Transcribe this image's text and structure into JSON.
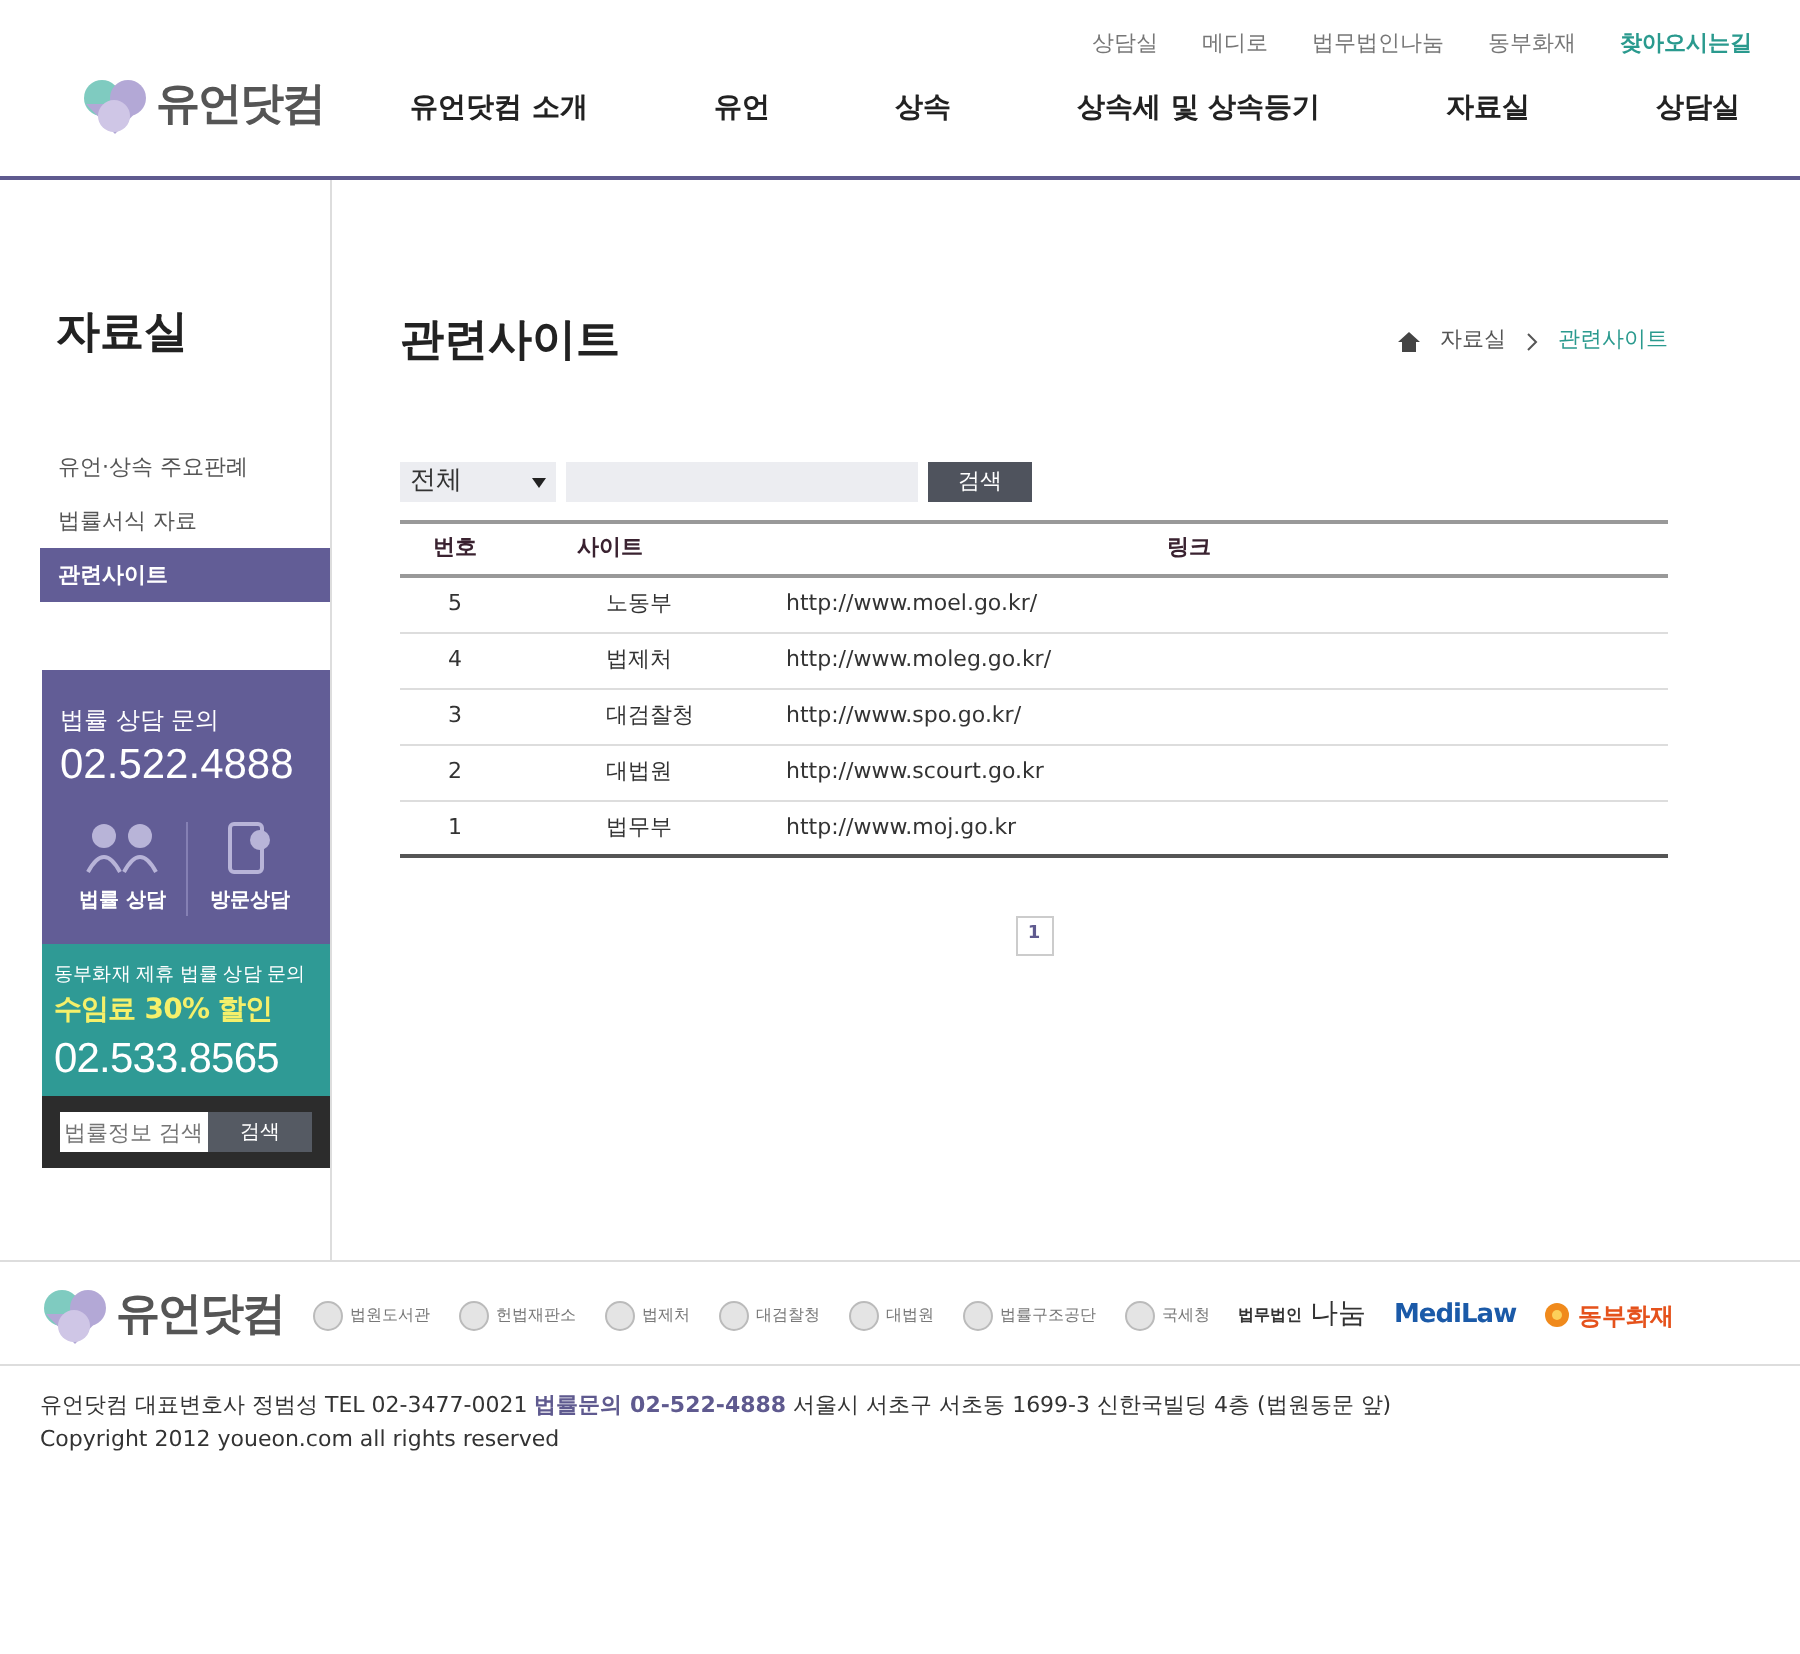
{
  "header": {
    "logo_text": "유언닷컴",
    "util_links": [
      {
        "label": "상담실",
        "selected": false
      },
      {
        "label": "메디로",
        "selected": false
      },
      {
        "label": "법무법인나눔",
        "selected": false
      },
      {
        "label": "동부화재",
        "selected": false
      },
      {
        "label": "찾아오시는길",
        "selected": true
      }
    ],
    "nav": [
      "유언닷컴 소개",
      "유언",
      "상속",
      "상속세 및 상속등기",
      "자료실",
      "상담실"
    ]
  },
  "sidebar": {
    "title": "자료실",
    "items": [
      {
        "label": "유언·상속 주요판례",
        "selected": false
      },
      {
        "label": "법률서식 자료",
        "selected": false
      },
      {
        "label": "관련사이트",
        "selected": true
      }
    ],
    "consult": {
      "label": "법률 상담 문의",
      "phone": "02.522.4888",
      "buttons": [
        {
          "kind": "people",
          "label": "법률 상담"
        },
        {
          "kind": "phone",
          "label": "방문상담"
        }
      ]
    },
    "promo": {
      "label": "동부화재 제휴 법률 상담 문의",
      "highlight": "수임료 30% 할인",
      "phone": "02.533.8565"
    },
    "search": {
      "placeholder": "법률정보 검색",
      "button": "검색"
    }
  },
  "content": {
    "title": "관련사이트",
    "breadcrumb": [
      "자료실",
      "관련사이트"
    ],
    "filter": {
      "value": "전체",
      "button": "검색"
    },
    "table": {
      "columns": [
        "번호",
        "사이트",
        "링크"
      ],
      "rows": [
        [
          "5",
          "노동부",
          "http://www.moel.go.kr/"
        ],
        [
          "4",
          "법제처",
          "http://www.moleg.go.kr/"
        ],
        [
          "3",
          "대검찰청",
          "http://www.spo.go.kr/"
        ],
        [
          "2",
          "대법원",
          "http://www.scourt.go.kr"
        ],
        [
          "1",
          "법무부",
          "http://www.moj.go.kr"
        ]
      ]
    },
    "pagination": [
      {
        "label": "1",
        "selected": true
      }
    ]
  },
  "footer": {
    "logo_text": "유언닷컴",
    "partners": [
      {
        "kind": "emblem",
        "label": "법원도서관"
      },
      {
        "kind": "emblem",
        "label": "헌법재판소"
      },
      {
        "kind": "emblem",
        "label": "법제처"
      },
      {
        "kind": "emblem",
        "label": "대검찰청"
      },
      {
        "kind": "emblem",
        "label": "대법원"
      },
      {
        "kind": "emblem",
        "label": "법률구조공단"
      },
      {
        "kind": "emblem",
        "label": "국세청"
      },
      {
        "kind": "firm",
        "prefix": "법무법인",
        "label": "나눔"
      },
      {
        "kind": "wordmark",
        "label": "MediLaw"
      },
      {
        "kind": "flower",
        "label": "동부화재"
      }
    ],
    "info": "유언닷컴 대표변호사 정범성 TEL 02-3477-0021 **법률문의 02-522-4888** 서울시 서초구 서초동 1699-3 신한국빌딩 4층 (법원동문 앞)",
    "copyright": "Copyright 2012 youeon.com  all rights reserved"
  }
}
